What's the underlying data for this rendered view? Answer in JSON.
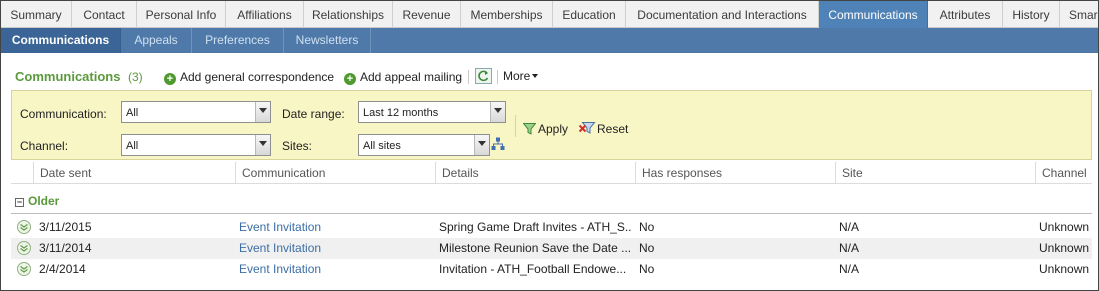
{
  "tabs": [
    {
      "label": "Summary",
      "active": false
    },
    {
      "label": "Contact",
      "active": false
    },
    {
      "label": "Personal Info",
      "active": false
    },
    {
      "label": "Affiliations",
      "active": false
    },
    {
      "label": "Relationships",
      "active": false
    },
    {
      "label": "Revenue",
      "active": false
    },
    {
      "label": "Memberships",
      "active": false
    },
    {
      "label": "Education",
      "active": false
    },
    {
      "label": "Documentation and Interactions",
      "active": false
    },
    {
      "label": "Communications",
      "active": true
    },
    {
      "label": "Attributes",
      "active": false
    },
    {
      "label": "History",
      "active": false
    },
    {
      "label": "Smar",
      "active": false
    }
  ],
  "subtabs": [
    {
      "label": "Communications",
      "active": true
    },
    {
      "label": "Appeals",
      "active": false
    },
    {
      "label": "Preferences",
      "active": false
    },
    {
      "label": "Newsletters",
      "active": false
    }
  ],
  "section": {
    "title": "Communications",
    "count": "(3)",
    "actions": {
      "add_general": "Add general correspondence",
      "add_appeal": "Add appeal mailing",
      "more": "More"
    }
  },
  "filters": {
    "communication_label": "Communication:",
    "communication_value": "All",
    "date_range_label": "Date range:",
    "date_range_value": "Last 12 months",
    "channel_label": "Channel:",
    "channel_value": "All",
    "sites_label": "Sites:",
    "sites_value": "All sites",
    "apply_label": "Apply",
    "reset_label": "Reset"
  },
  "table": {
    "columns": [
      "Date sent",
      "Communication",
      "Details",
      "Has responses",
      "Site",
      "Channel"
    ],
    "group_label": "Older",
    "rows": [
      {
        "date_sent": "3/11/2015",
        "communication": "Event Invitation",
        "details": "Spring Game Draft Invites - ATH_S...",
        "has_responses": "No",
        "site": "N/A",
        "channel": "Unknown"
      },
      {
        "date_sent": "3/11/2014",
        "communication": "Event Invitation",
        "details": "Milestone Reunion Save the Date ...",
        "has_responses": "No",
        "site": "N/A",
        "channel": "Unknown"
      },
      {
        "date_sent": "2/4/2014",
        "communication": "Event Invitation",
        "details": "Invitation - ATH_Football Endowe...",
        "has_responses": "No",
        "site": "N/A",
        "channel": "Unknown"
      }
    ]
  },
  "colors": {
    "accent_blue": "#4f82b6",
    "subtab_bar": "#4e79a8",
    "section_green": "#5b9a3c",
    "filter_bg": "#f8f6c5",
    "link_blue": "#3b6ea5"
  }
}
